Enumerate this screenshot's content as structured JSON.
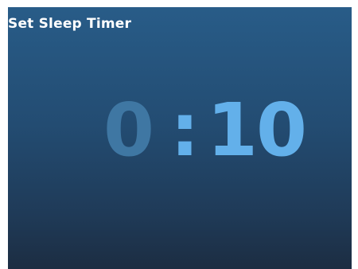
{
  "screen": {
    "title": "Set Sleep Timer"
  },
  "timer": {
    "hours": "0",
    "separator": ":",
    "minutes": "10"
  },
  "colors": {
    "background_top": "#285c88",
    "background_bottom": "#1c2d42",
    "inactive_digit": "#3f77a3",
    "active_digit": "#63b0ea",
    "title_text": "#ffffff"
  }
}
